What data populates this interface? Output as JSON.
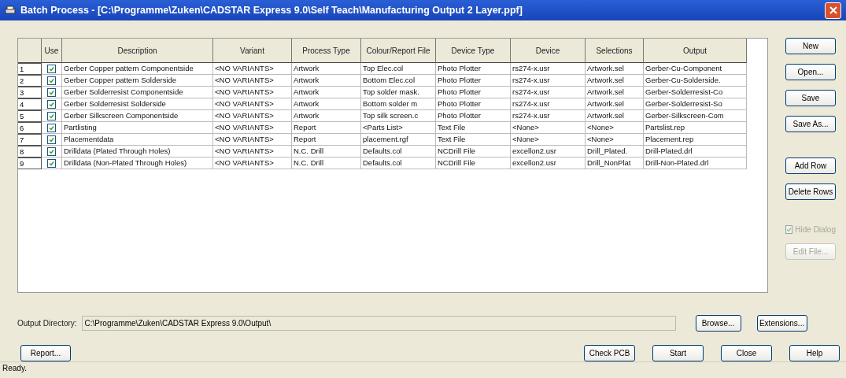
{
  "window": {
    "title": "Batch Process - [C:\\Programme\\Zuken\\CADSTAR Express 9.0\\Self Teach\\Manufacturing Output 2 Layer.ppf]"
  },
  "table": {
    "columns": [
      "",
      "Use",
      "Description",
      "Variant",
      "Process Type",
      "Colour/Report File",
      "Device Type",
      "Device",
      "Selections",
      "Output"
    ],
    "rows": [
      {
        "use": true,
        "cells": [
          "1",
          "",
          "Gerber Copper pattern Componentside",
          "<NO VARIANTS>",
          "Artwork",
          "Top Elec.col",
          "Photo Plotter",
          "rs274-x.usr",
          "Artwork.sel",
          "Gerber-Cu-Component"
        ]
      },
      {
        "use": true,
        "cells": [
          "2",
          "",
          "Gerber Copper pattern Solderside",
          "<NO VARIANTS>",
          "Artwork",
          "Bottom Elec.col",
          "Photo Plotter",
          "rs274-x.usr",
          "Artwork.sel",
          "Gerber-Cu-Solderside."
        ]
      },
      {
        "use": true,
        "cells": [
          "3",
          "",
          "Gerber Solderresist Componentside",
          "<NO VARIANTS>",
          "Artwork",
          "Top solder mask.",
          "Photo Plotter",
          "rs274-x.usr",
          "Artwork.sel",
          "Gerber-Solderresist-Co"
        ]
      },
      {
        "use": true,
        "cells": [
          "4",
          "",
          "Gerber Solderresist Solderside",
          "<NO VARIANTS>",
          "Artwork",
          "Bottom solder m",
          "Photo Plotter",
          "rs274-x.usr",
          "Artwork.sel",
          "Gerber-Solderresist-So"
        ]
      },
      {
        "use": true,
        "cells": [
          "5",
          "",
          "Gerber Silkscreen Componentside",
          "<NO VARIANTS>",
          "Artwork",
          "Top silk screen.c",
          "Photo Plotter",
          "rs274-x.usr",
          "Artwork.sel",
          "Gerber-Silkscreen-Com"
        ]
      },
      {
        "use": true,
        "cells": [
          "6",
          "",
          "Partlisting",
          "<NO VARIANTS>",
          "Report",
          "<Parts List>",
          "Text File",
          "<None>",
          "<None>",
          "Partslist.rep"
        ]
      },
      {
        "use": true,
        "cells": [
          "7",
          "",
          "Placementdata",
          "<NO VARIANTS>",
          "Report",
          "placement.rgf",
          "Text File",
          "<None>",
          "<None>",
          "Placement.rep"
        ]
      },
      {
        "use": true,
        "cells": [
          "8",
          "",
          "Drilldata (Plated Through Holes)",
          "<NO VARIANTS>",
          "N.C. Drill",
          "Defaults.col",
          "NCDrill File",
          "excellon2.usr",
          "Drill_Plated.",
          "Drill-Plated.drl"
        ]
      },
      {
        "use": true,
        "cells": [
          "9",
          "",
          "Drilldata (Non-Plated Through Holes)",
          "<NO VARIANTS>",
          "N.C. Drill",
          "Defaults.col",
          "NCDrill File",
          "excellon2.usr",
          "Drill_NonPlat",
          "Drill-Non-Plated.drl"
        ]
      }
    ]
  },
  "side_buttons": [
    {
      "kind": "button",
      "label": "New",
      "disabled": false
    },
    {
      "kind": "button",
      "label": "Open...",
      "disabled": false
    },
    {
      "kind": "button",
      "label": "Save",
      "disabled": false
    },
    {
      "kind": "button",
      "label": "Save As...",
      "disabled": false
    },
    {
      "kind": "gap"
    },
    {
      "kind": "button",
      "label": "Add Row",
      "disabled": false
    },
    {
      "kind": "button",
      "label": "Delete Rows",
      "disabled": false
    },
    {
      "kind": "gap"
    },
    {
      "kind": "checkbox",
      "label": "Hide Dialog",
      "checked": true,
      "disabled": true
    },
    {
      "kind": "button",
      "label": "Edit File...",
      "disabled": true
    }
  ],
  "output_directory": {
    "label": "Output Directory:",
    "value": "C:\\Programme\\Zuken\\CADSTAR Express 9.0\\Output\\",
    "browse": "Browse...",
    "extensions": "Extensions..."
  },
  "bottom_buttons": {
    "left": [
      "Report..."
    ],
    "right": [
      "Check PCB",
      "Start",
      "Close",
      "Help"
    ]
  },
  "status_bar": "Ready."
}
